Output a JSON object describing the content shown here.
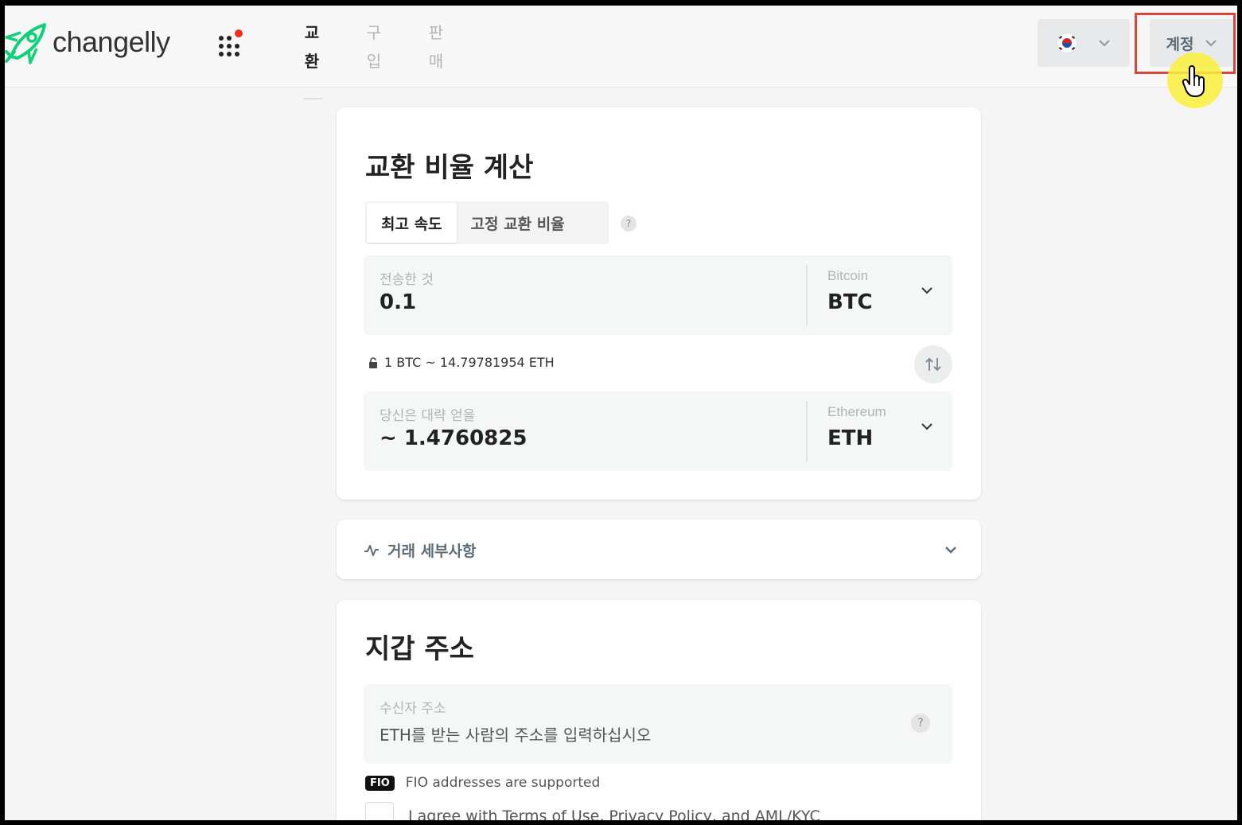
{
  "header": {
    "logo_text": "changelly",
    "nav": [
      {
        "label": "교\n환",
        "top": "교",
        "bottom": "환"
      },
      {
        "label": "구\n입",
        "top": "구",
        "bottom": "입"
      },
      {
        "label": "판\n매",
        "top": "판",
        "bottom": "매"
      }
    ],
    "account_label": "계정"
  },
  "calc": {
    "title": "교환 비율 계산",
    "tabs": [
      "최고 속도",
      "고정 교환 비율"
    ],
    "help_glyph": "?",
    "send": {
      "label": "전송한 것",
      "value": "0.1",
      "coin_name": "Bitcoin",
      "coin_ticker": "BTC"
    },
    "rate": "1 BTC ~ 14.79781954 ETH",
    "receive": {
      "label": "당신은 대략 얻을",
      "value": "~ 1.4760825",
      "coin_name": "Ethereum",
      "coin_ticker": "ETH"
    }
  },
  "details": {
    "label": "거래 세부사항"
  },
  "wallet": {
    "title": "지갑 주소",
    "recipient_label": "수신자 주소",
    "recipient_placeholder": "ETH를 받는 사람의 주소를 입력하십시오",
    "fio_badge": "FIO",
    "fio_text": "FIO addresses are supported",
    "agree_text": "I agree with Terms of Use, Privacy Policy, and AML/KYC"
  },
  "colors": {
    "brand_green": "#10d078",
    "highlight": "#d9473b",
    "cursor_glow": "#faf03c"
  }
}
